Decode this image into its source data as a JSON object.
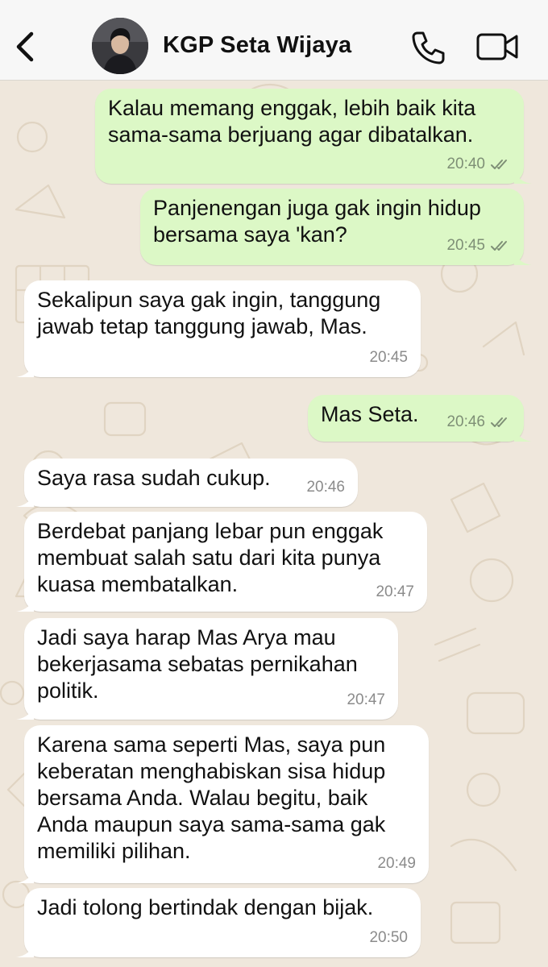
{
  "header": {
    "contact_name": "KGP Seta Wijaya"
  },
  "icons": {
    "back": "chevron-left-icon",
    "call": "phone-icon",
    "video": "video-camera-icon",
    "read": "double-check-icon"
  },
  "colors": {
    "outgoing_bubble": "#dcf8c6",
    "incoming_bubble": "#ffffff",
    "wallpaper": "#efe7dc",
    "header_bg": "#f7f7f7"
  },
  "messages": [
    {
      "direction": "out",
      "text": "Kalau memang enggak, lebih baik kita\nsama-sama berjuang agar dibatalkan.",
      "time": "20:40"
    },
    {
      "direction": "out",
      "text": "Panjenengan juga gak ingin hidup\nbersama saya 'kan?",
      "time": "20:45"
    },
    {
      "direction": "in",
      "text": "Sekalipun saya gak ingin, tanggung\njawab tetap tanggung jawab, Mas.",
      "time": "20:45"
    },
    {
      "direction": "out",
      "text": "Mas Seta.",
      "time": "20:46"
    },
    {
      "direction": "in",
      "text": "Saya rasa sudah cukup.",
      "time": "20:46"
    },
    {
      "direction": "in",
      "text": "Berdebat panjang lebar pun enggak\nmembuat salah satu dari kita punya\nkuasa membatalkan.",
      "time": "20:47"
    },
    {
      "direction": "in",
      "text": "Jadi saya harap Mas Arya mau\nbekerjasama sebatas pernikahan\npolitik.",
      "time": "20:47"
    },
    {
      "direction": "in",
      "text": "Karena sama seperti Mas, saya pun\nkeberatan menghabiskan sisa hidup\nbersama Anda. Walau begitu, baik\nAnda maupun saya sama-sama gak\nmemiliki pilihan.",
      "time": "20:49"
    },
    {
      "direction": "in",
      "text": "Jadi tolong bertindak dengan bijak.",
      "time": "20:50"
    }
  ]
}
